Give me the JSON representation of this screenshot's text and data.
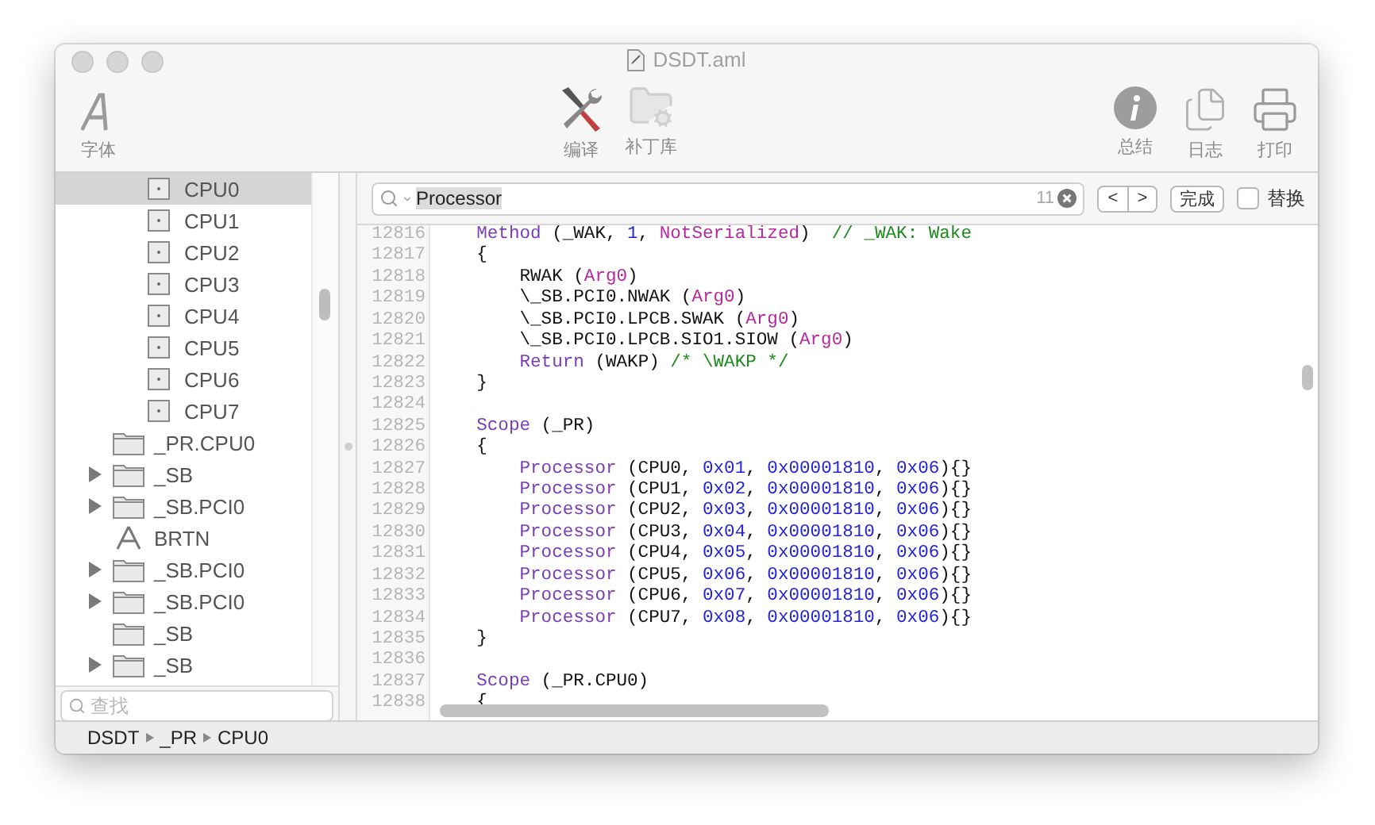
{
  "window": {
    "title": "DSDT.aml"
  },
  "toolbar": {
    "left": [
      {
        "kind": "font",
        "label": "字体"
      }
    ],
    "center": [
      {
        "kind": "compile",
        "label": "编译"
      },
      {
        "kind": "patch",
        "label": "补丁库"
      }
    ],
    "right": [
      {
        "kind": "summary",
        "label": "总结"
      },
      {
        "kind": "log",
        "label": "日志"
      },
      {
        "kind": "print",
        "label": "打印"
      }
    ]
  },
  "sidebar": {
    "tree": [
      {
        "children": [
          {
            "label": "CPU0",
            "kind": "processor",
            "selected": true
          },
          {
            "label": "CPU1",
            "kind": "processor",
            "selected": false
          },
          {
            "label": "CPU2",
            "kind": "processor",
            "selected": false
          },
          {
            "label": "CPU3",
            "kind": "processor",
            "selected": false
          },
          {
            "label": "CPU4",
            "kind": "processor",
            "selected": false
          },
          {
            "label": "CPU5",
            "kind": "processor",
            "selected": false
          },
          {
            "label": "CPU6",
            "kind": "processor",
            "selected": false
          },
          {
            "label": "CPU7",
            "kind": "processor",
            "selected": false
          }
        ]
      },
      {
        "label": "_PR.CPU0",
        "kind": "scope",
        "expandable": false,
        "selected": false
      },
      {
        "label": "_SB",
        "kind": "scope",
        "expandable": true,
        "expanded": false,
        "selected": false
      },
      {
        "label": "_SB.PCI0",
        "kind": "scope",
        "expandable": true,
        "expanded": false,
        "selected": false
      },
      {
        "label": "BRTN",
        "kind": "method",
        "expandable": false,
        "selected": false
      },
      {
        "label": "_SB.PCI0",
        "kind": "scope",
        "expandable": true,
        "expanded": false,
        "selected": false
      },
      {
        "label": "_SB.PCI0",
        "kind": "scope",
        "expandable": true,
        "expanded": false,
        "selected": false
      },
      {
        "label": "_SB",
        "kind": "scope",
        "expandable": false,
        "selected": false
      },
      {
        "label": "_SB",
        "kind": "scope",
        "expandable": true,
        "expanded": false,
        "selected": false
      }
    ],
    "search": {
      "placeholder": "查找"
    }
  },
  "find_bar": {
    "value": "Processor",
    "match_count": "11",
    "prev": "<",
    "next": ">",
    "done": "完成",
    "replace": {
      "label": "替换",
      "checked": false
    }
  },
  "editor": {
    "lines": [
      {
        "number": "12816",
        "tokens": [
          {
            "kind": "keyword",
            "text": "    Method"
          },
          {
            "kind": "plain",
            "text": " (_WAK, "
          },
          {
            "kind": "number",
            "text": "1"
          },
          {
            "kind": "plain",
            "text": ", "
          },
          {
            "kind": "argument",
            "text": "NotSerialized"
          },
          {
            "kind": "plain",
            "text": ")  "
          },
          {
            "kind": "comment",
            "text": "// _WAK: Wake"
          }
        ]
      },
      {
        "number": "12817",
        "tokens": [
          {
            "kind": "plain",
            "text": "    {"
          }
        ]
      },
      {
        "number": "12818",
        "tokens": [
          {
            "kind": "plain",
            "text": "        RWAK ("
          },
          {
            "kind": "argument",
            "text": "Arg0"
          },
          {
            "kind": "plain",
            "text": ")"
          }
        ]
      },
      {
        "number": "12819",
        "tokens": [
          {
            "kind": "plain",
            "text": "        \\_SB.PCI0.NWAK ("
          },
          {
            "kind": "argument",
            "text": "Arg0"
          },
          {
            "kind": "plain",
            "text": ")"
          }
        ]
      },
      {
        "number": "12820",
        "tokens": [
          {
            "kind": "plain",
            "text": "        \\_SB.PCI0.LPCB.SWAK ("
          },
          {
            "kind": "argument",
            "text": "Arg0"
          },
          {
            "kind": "plain",
            "text": ")"
          }
        ]
      },
      {
        "number": "12821",
        "tokens": [
          {
            "kind": "plain",
            "text": "        \\_SB.PCI0.LPCB.SIO1.SIOW ("
          },
          {
            "kind": "argument",
            "text": "Arg0"
          },
          {
            "kind": "plain",
            "text": ")"
          }
        ]
      },
      {
        "number": "12822",
        "tokens": [
          {
            "kind": "keyword",
            "text": "        Return"
          },
          {
            "kind": "plain",
            "text": " (WAKP) "
          },
          {
            "kind": "comment",
            "text": "/* \\WAKP */"
          }
        ]
      },
      {
        "number": "12823",
        "tokens": [
          {
            "kind": "plain",
            "text": "    }"
          }
        ]
      },
      {
        "number": "12824"
      },
      {
        "number": "12825",
        "tokens": [
          {
            "kind": "keyword",
            "text": "    Scope"
          },
          {
            "kind": "plain",
            "text": " (_PR)"
          }
        ]
      },
      {
        "number": "12826",
        "tokens": [
          {
            "kind": "plain",
            "text": "    {"
          }
        ]
      },
      {
        "number": "12827",
        "tokens": [
          {
            "kind": "keyword",
            "text": "        Processor"
          },
          {
            "kind": "plain",
            "text": " (CPU0, "
          },
          {
            "kind": "number",
            "text": "0x01"
          },
          {
            "kind": "plain",
            "text": ", "
          },
          {
            "kind": "number",
            "text": "0x00001810"
          },
          {
            "kind": "plain",
            "text": ", "
          },
          {
            "kind": "number",
            "text": "0x06"
          },
          {
            "kind": "plain",
            "text": "){}"
          }
        ]
      },
      {
        "number": "12828",
        "tokens": [
          {
            "kind": "keyword",
            "text": "        Processor"
          },
          {
            "kind": "plain",
            "text": " (CPU1, "
          },
          {
            "kind": "number",
            "text": "0x02"
          },
          {
            "kind": "plain",
            "text": ", "
          },
          {
            "kind": "number",
            "text": "0x00001810"
          },
          {
            "kind": "plain",
            "text": ", "
          },
          {
            "kind": "number",
            "text": "0x06"
          },
          {
            "kind": "plain",
            "text": "){}"
          }
        ]
      },
      {
        "number": "12829",
        "tokens": [
          {
            "kind": "keyword",
            "text": "        Processor"
          },
          {
            "kind": "plain",
            "text": " (CPU2, "
          },
          {
            "kind": "number",
            "text": "0x03"
          },
          {
            "kind": "plain",
            "text": ", "
          },
          {
            "kind": "number",
            "text": "0x00001810"
          },
          {
            "kind": "plain",
            "text": ", "
          },
          {
            "kind": "number",
            "text": "0x06"
          },
          {
            "kind": "plain",
            "text": "){}"
          }
        ]
      },
      {
        "number": "12830",
        "tokens": [
          {
            "kind": "keyword",
            "text": "        Processor"
          },
          {
            "kind": "plain",
            "text": " (CPU3, "
          },
          {
            "kind": "number",
            "text": "0x04"
          },
          {
            "kind": "plain",
            "text": ", "
          },
          {
            "kind": "number",
            "text": "0x00001810"
          },
          {
            "kind": "plain",
            "text": ", "
          },
          {
            "kind": "number",
            "text": "0x06"
          },
          {
            "kind": "plain",
            "text": "){}"
          }
        ]
      },
      {
        "number": "12831",
        "tokens": [
          {
            "kind": "keyword",
            "text": "        Processor"
          },
          {
            "kind": "plain",
            "text": " (CPU4, "
          },
          {
            "kind": "number",
            "text": "0x05"
          },
          {
            "kind": "plain",
            "text": ", "
          },
          {
            "kind": "number",
            "text": "0x00001810"
          },
          {
            "kind": "plain",
            "text": ", "
          },
          {
            "kind": "number",
            "text": "0x06"
          },
          {
            "kind": "plain",
            "text": "){}"
          }
        ]
      },
      {
        "number": "12832",
        "tokens": [
          {
            "kind": "keyword",
            "text": "        Processor"
          },
          {
            "kind": "plain",
            "text": " (CPU5, "
          },
          {
            "kind": "number",
            "text": "0x06"
          },
          {
            "kind": "plain",
            "text": ", "
          },
          {
            "kind": "number",
            "text": "0x00001810"
          },
          {
            "kind": "plain",
            "text": ", "
          },
          {
            "kind": "number",
            "text": "0x06"
          },
          {
            "kind": "plain",
            "text": "){}"
          }
        ]
      },
      {
        "number": "12833",
        "tokens": [
          {
            "kind": "keyword",
            "text": "        Processor"
          },
          {
            "kind": "plain",
            "text": " (CPU6, "
          },
          {
            "kind": "number",
            "text": "0x07"
          },
          {
            "kind": "plain",
            "text": ", "
          },
          {
            "kind": "number",
            "text": "0x00001810"
          },
          {
            "kind": "plain",
            "text": ", "
          },
          {
            "kind": "number",
            "text": "0x06"
          },
          {
            "kind": "plain",
            "text": "){}"
          }
        ]
      },
      {
        "number": "12834",
        "tokens": [
          {
            "kind": "keyword",
            "text": "        Processor"
          },
          {
            "kind": "plain",
            "text": " (CPU7, "
          },
          {
            "kind": "number",
            "text": "0x08"
          },
          {
            "kind": "plain",
            "text": ", "
          },
          {
            "kind": "number",
            "text": "0x00001810"
          },
          {
            "kind": "plain",
            "text": ", "
          },
          {
            "kind": "number",
            "text": "0x06"
          },
          {
            "kind": "plain",
            "text": "){}"
          }
        ]
      },
      {
        "number": "12835",
        "tokens": [
          {
            "kind": "plain",
            "text": "    }"
          }
        ]
      },
      {
        "number": "12836"
      },
      {
        "number": "12837",
        "tokens": [
          {
            "kind": "keyword",
            "text": "    Scope"
          },
          {
            "kind": "plain",
            "text": " (_PR.CPU0)"
          }
        ]
      },
      {
        "number": "12838",
        "tokens": [
          {
            "kind": "plain",
            "text": "    {"
          }
        ]
      }
    ]
  },
  "status_bar": {
    "path": [
      "DSDT",
      "_PR",
      "CPU0"
    ]
  }
}
